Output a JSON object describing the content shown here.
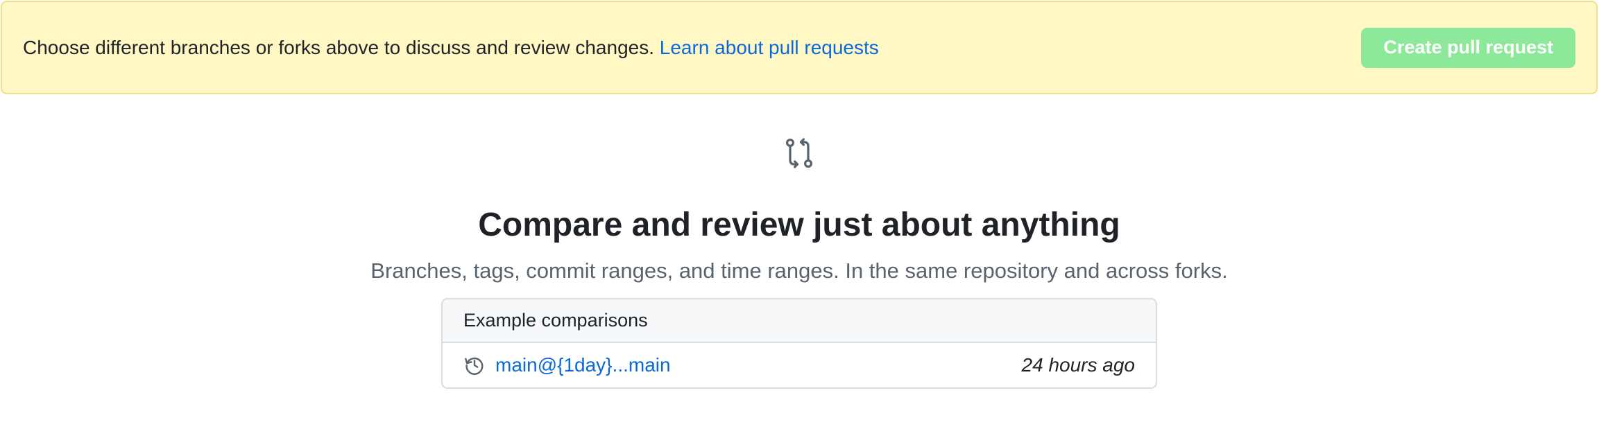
{
  "banner": {
    "message": "Choose different branches or forks above to discuss and review changes.",
    "link_text": "Learn about pull requests",
    "create_button_label": "Create pull request"
  },
  "blankslate": {
    "icon": "git-pull-request-icon",
    "title": "Compare and review just about anything",
    "subtitle": "Branches, tags, commit ranges, and time ranges. In the same repository and across forks."
  },
  "examples": {
    "header": "Example comparisons",
    "items": [
      {
        "icon": "history-icon",
        "label": "main@{1day}...main",
        "time": "24 hours ago"
      }
    ]
  },
  "colors": {
    "banner_bg": "#fff8c5",
    "link": "#0969da",
    "button_disabled": "#8ce99a"
  }
}
